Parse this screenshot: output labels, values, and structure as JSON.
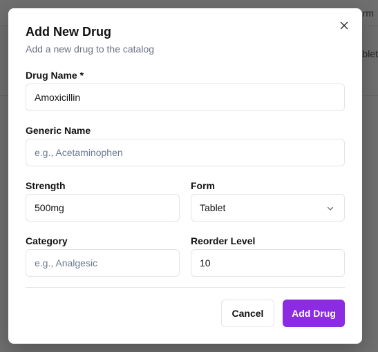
{
  "background": {
    "column_header": "Form",
    "cell_text": "Tablet"
  },
  "dialog": {
    "title": "Add New Drug",
    "subtitle": "Add a new drug to the catalog",
    "close_icon": "close-icon"
  },
  "fields": {
    "drug_name": {
      "label": "Drug Name *",
      "value": "Amoxicillin",
      "placeholder": ""
    },
    "generic_name": {
      "label": "Generic Name",
      "value": "",
      "placeholder": "e.g., Acetaminophen"
    },
    "strength": {
      "label": "Strength",
      "value": "500mg",
      "placeholder": ""
    },
    "form": {
      "label": "Form",
      "value": "Tablet",
      "icon": "chevron-down-icon"
    },
    "category": {
      "label": "Category",
      "value": "",
      "placeholder": "e.g., Analgesic"
    },
    "reorder_level": {
      "label": "Reorder Level",
      "value": "10",
      "placeholder": ""
    }
  },
  "actions": {
    "cancel_label": "Cancel",
    "submit_label": "Add Drug"
  },
  "colors": {
    "primary": "#8b2be2",
    "backdrop": "#707070"
  }
}
